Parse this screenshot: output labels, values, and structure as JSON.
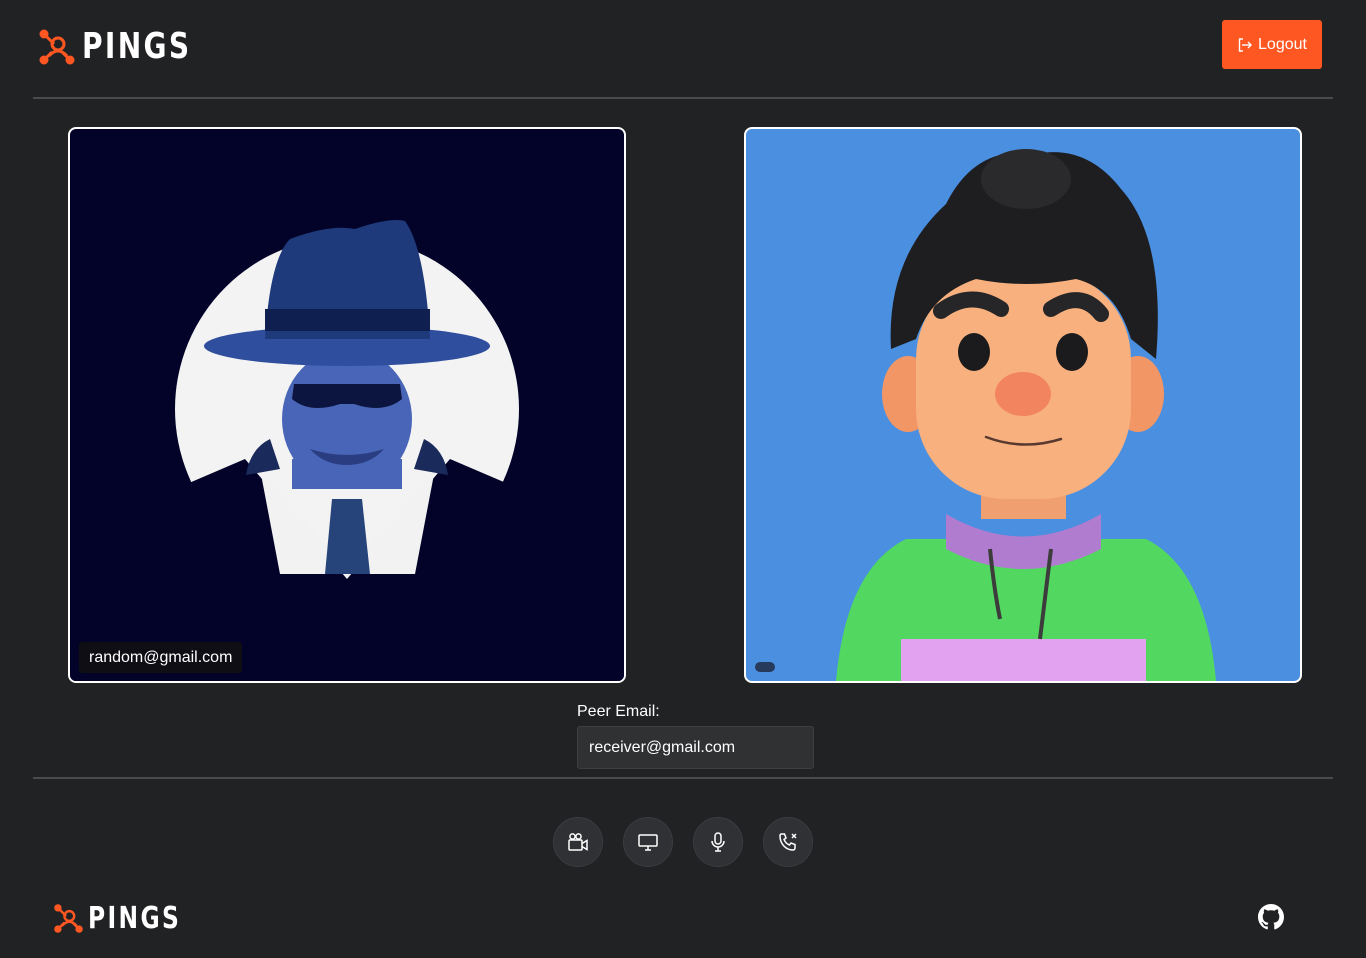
{
  "app": {
    "brand_name": "PINGS",
    "accent_color": "#fe5722"
  },
  "header": {
    "logout_label": "Logout",
    "logout_icon": "logout-icon"
  },
  "videos": {
    "local": {
      "email_label": "random@gmail.com"
    },
    "remote": {
      "email_label": ""
    }
  },
  "peer": {
    "label": "Peer Email:",
    "value": "receiver@gmail.com"
  },
  "controls": [
    {
      "icon": "camera-icon"
    },
    {
      "icon": "screen-share-icon"
    },
    {
      "icon": "microphone-icon"
    },
    {
      "icon": "end-call-icon"
    }
  ],
  "footer": {
    "brand_name": "PINGS",
    "github_icon": "github-icon"
  }
}
